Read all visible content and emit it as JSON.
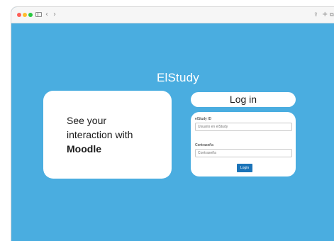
{
  "browser": {
    "icons": {
      "back": "chevron-left-icon",
      "forward": "chevron-right-icon",
      "share": "share-icon",
      "new_tab": "plus-icon",
      "tabs": "tabs-icon"
    }
  },
  "page": {
    "brand": "ElStudy",
    "background_color": "#4aade0",
    "intro": {
      "line1": "See your",
      "line2": "interaction with",
      "line3": "Moodle"
    },
    "login": {
      "title": "Log in",
      "id_label": "elStudy ID",
      "id_placeholder": "Usuario en elStudy",
      "password_label": "Contraseña",
      "password_placeholder": "Contraseña",
      "button_label": "Login",
      "button_color": "#1a73b8"
    }
  }
}
